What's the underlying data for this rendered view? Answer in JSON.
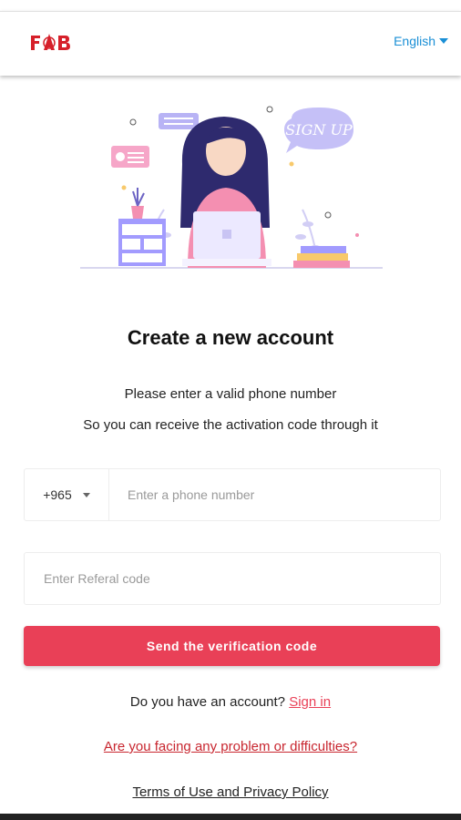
{
  "header": {
    "logo_alt": "FAB",
    "language": "English"
  },
  "illustration": {
    "speech_bubble_text": "SIGN UP"
  },
  "main": {
    "title": "Create a new account",
    "subtitle_line1": "Please enter a valid phone number",
    "subtitle_line2": "So you can receive the activation code through it"
  },
  "form": {
    "country_code": "+965",
    "phone_placeholder": "Enter a phone number",
    "referral_placeholder": "Enter Referal code",
    "submit_label": "Send the verification code"
  },
  "footer": {
    "have_account_text": "Do you have an account?",
    "sign_in_label": "Sign in",
    "problem_link": "Are you facing any problem or difficulties?",
    "terms_link": "Terms of Use and Privacy Policy"
  },
  "colors": {
    "accent": "#e94057",
    "link_blue": "#1a8fd6",
    "logo_red": "#d6202a",
    "illustration_purple": "#a29bfe",
    "illustration_pink": "#f48fb1"
  }
}
